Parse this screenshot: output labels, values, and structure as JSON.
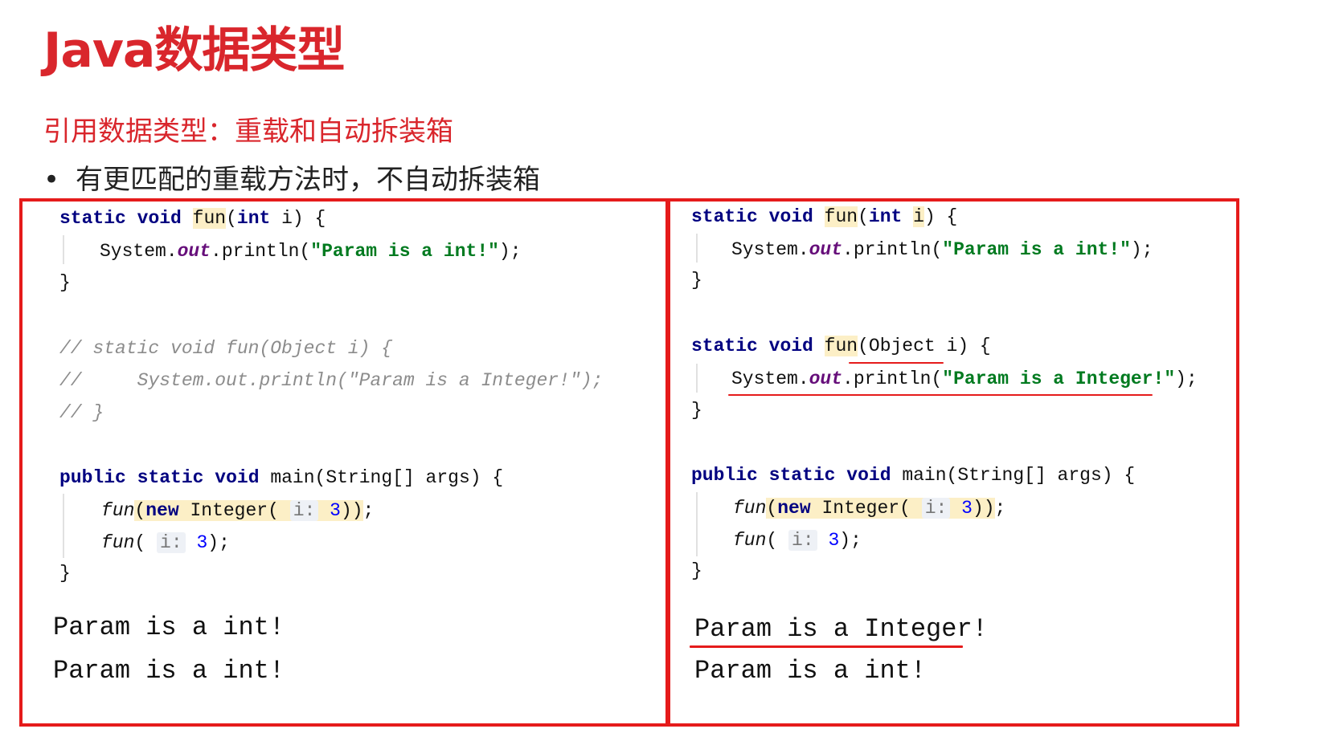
{
  "slide": {
    "title": "Java数据类型",
    "subtitle": "引用数据类型：重载和自动拆装箱",
    "bullet_marker": "•",
    "bullet": "有更匹配的重载方法时，不自动拆装箱"
  },
  "left_panel": {
    "code": {
      "l1": {
        "static": "static",
        "void": "void",
        "fun": "fun",
        "open": "(",
        "int": "int",
        "rest": " i) {"
      },
      "l2": {
        "sys": "System.",
        "out": "out",
        "print": ".println(",
        "str": "\"Param is a int!\"",
        "end": ");"
      },
      "l3": "}",
      "c1": "// static void fun(Object i) {",
      "c2": "//     System.out.println(\"Param is a Integer!\");",
      "c3": "// }",
      "m1": {
        "public": "public",
        "static": "static",
        "void": "void",
        "rest": "main(String[] args) {"
      },
      "m2": {
        "fun": "fun",
        "open": "(",
        "new": "new",
        "integer": "Integer(",
        "hint": "i:",
        "num": "3",
        "close": "))",
        "end": ";"
      },
      "m3": {
        "fun": "fun",
        "open": "(",
        "hint": "i:",
        "num": "3",
        "end": ");"
      },
      "m4": "}"
    },
    "output": [
      "Param is a int!",
      "Param is a int!"
    ]
  },
  "right_panel": {
    "code": {
      "l1": {
        "static": "static",
        "void": "void",
        "fun": "fun",
        "open": "(",
        "int": "int",
        "i": "i",
        "rest": ") {"
      },
      "l2": {
        "sys": "System.",
        "out": "out",
        "print": ".println(",
        "str": "\"Param is a int!\"",
        "end": ");"
      },
      "l3": "}",
      "o1": {
        "static": "static",
        "void": "void",
        "fun": "fun",
        "rest": "(Object i) {"
      },
      "o2": {
        "sys": "System.",
        "out": "out",
        "print": ".println(",
        "str": "\"Param is a Integer!\"",
        "end": ");"
      },
      "o3": "}",
      "m1": {
        "public": "public",
        "static": "static",
        "void": "void",
        "rest": "main(String[] args) {"
      },
      "m2": {
        "fun": "fun",
        "open": "(",
        "new": "new",
        "integer": "Integer(",
        "hint": "i:",
        "num": "3",
        "close": "))",
        "end": ";"
      },
      "m3": {
        "fun": "fun",
        "open": "(",
        "hint": "i:",
        "num": "3",
        "end": ");"
      },
      "m4": "}"
    },
    "output": [
      "Param is a Integer!",
      "Param is a int!"
    ]
  },
  "colors": {
    "accent_red": "#d9262c",
    "frame_red": "#e51b1b",
    "keyword": "#000080",
    "string": "#007a1f",
    "comment": "#8c8c8c",
    "highlight": "#fcefc6"
  }
}
